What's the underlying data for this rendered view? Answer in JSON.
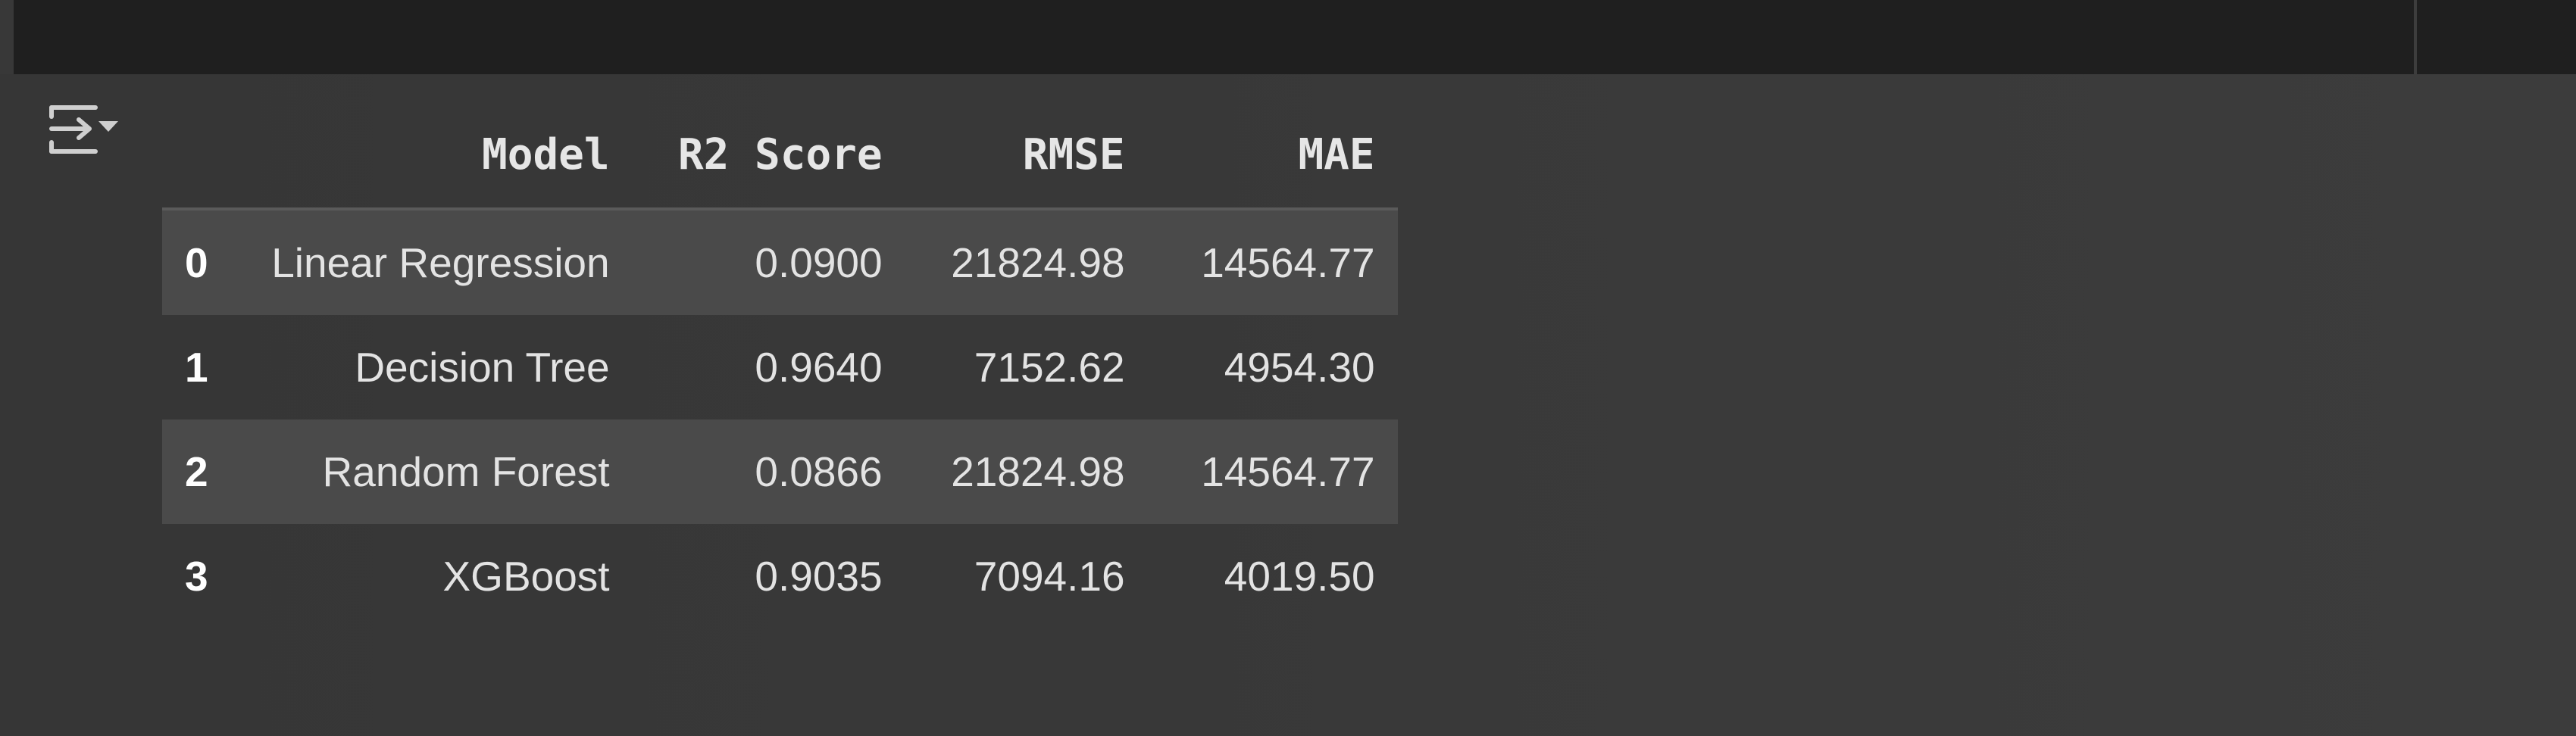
{
  "output": {
    "toggle_icon": "output-collapse-icon"
  },
  "table": {
    "columns": [
      "Model",
      "R2 Score",
      "RMSE",
      "MAE"
    ],
    "rows": [
      {
        "index": "0",
        "model": "Linear Regression",
        "r2": "0.0900",
        "rmse": "21824.98",
        "mae": "14564.77"
      },
      {
        "index": "1",
        "model": "Decision Tree",
        "r2": "0.9640",
        "rmse": "7152.62",
        "mae": "4954.30"
      },
      {
        "index": "2",
        "model": "Random Forest",
        "r2": "0.0866",
        "rmse": "21824.98",
        "mae": "14564.77"
      },
      {
        "index": "3",
        "model": "XGBoost",
        "r2": "0.9035",
        "rmse": "7094.16",
        "mae": "4019.50"
      }
    ]
  }
}
